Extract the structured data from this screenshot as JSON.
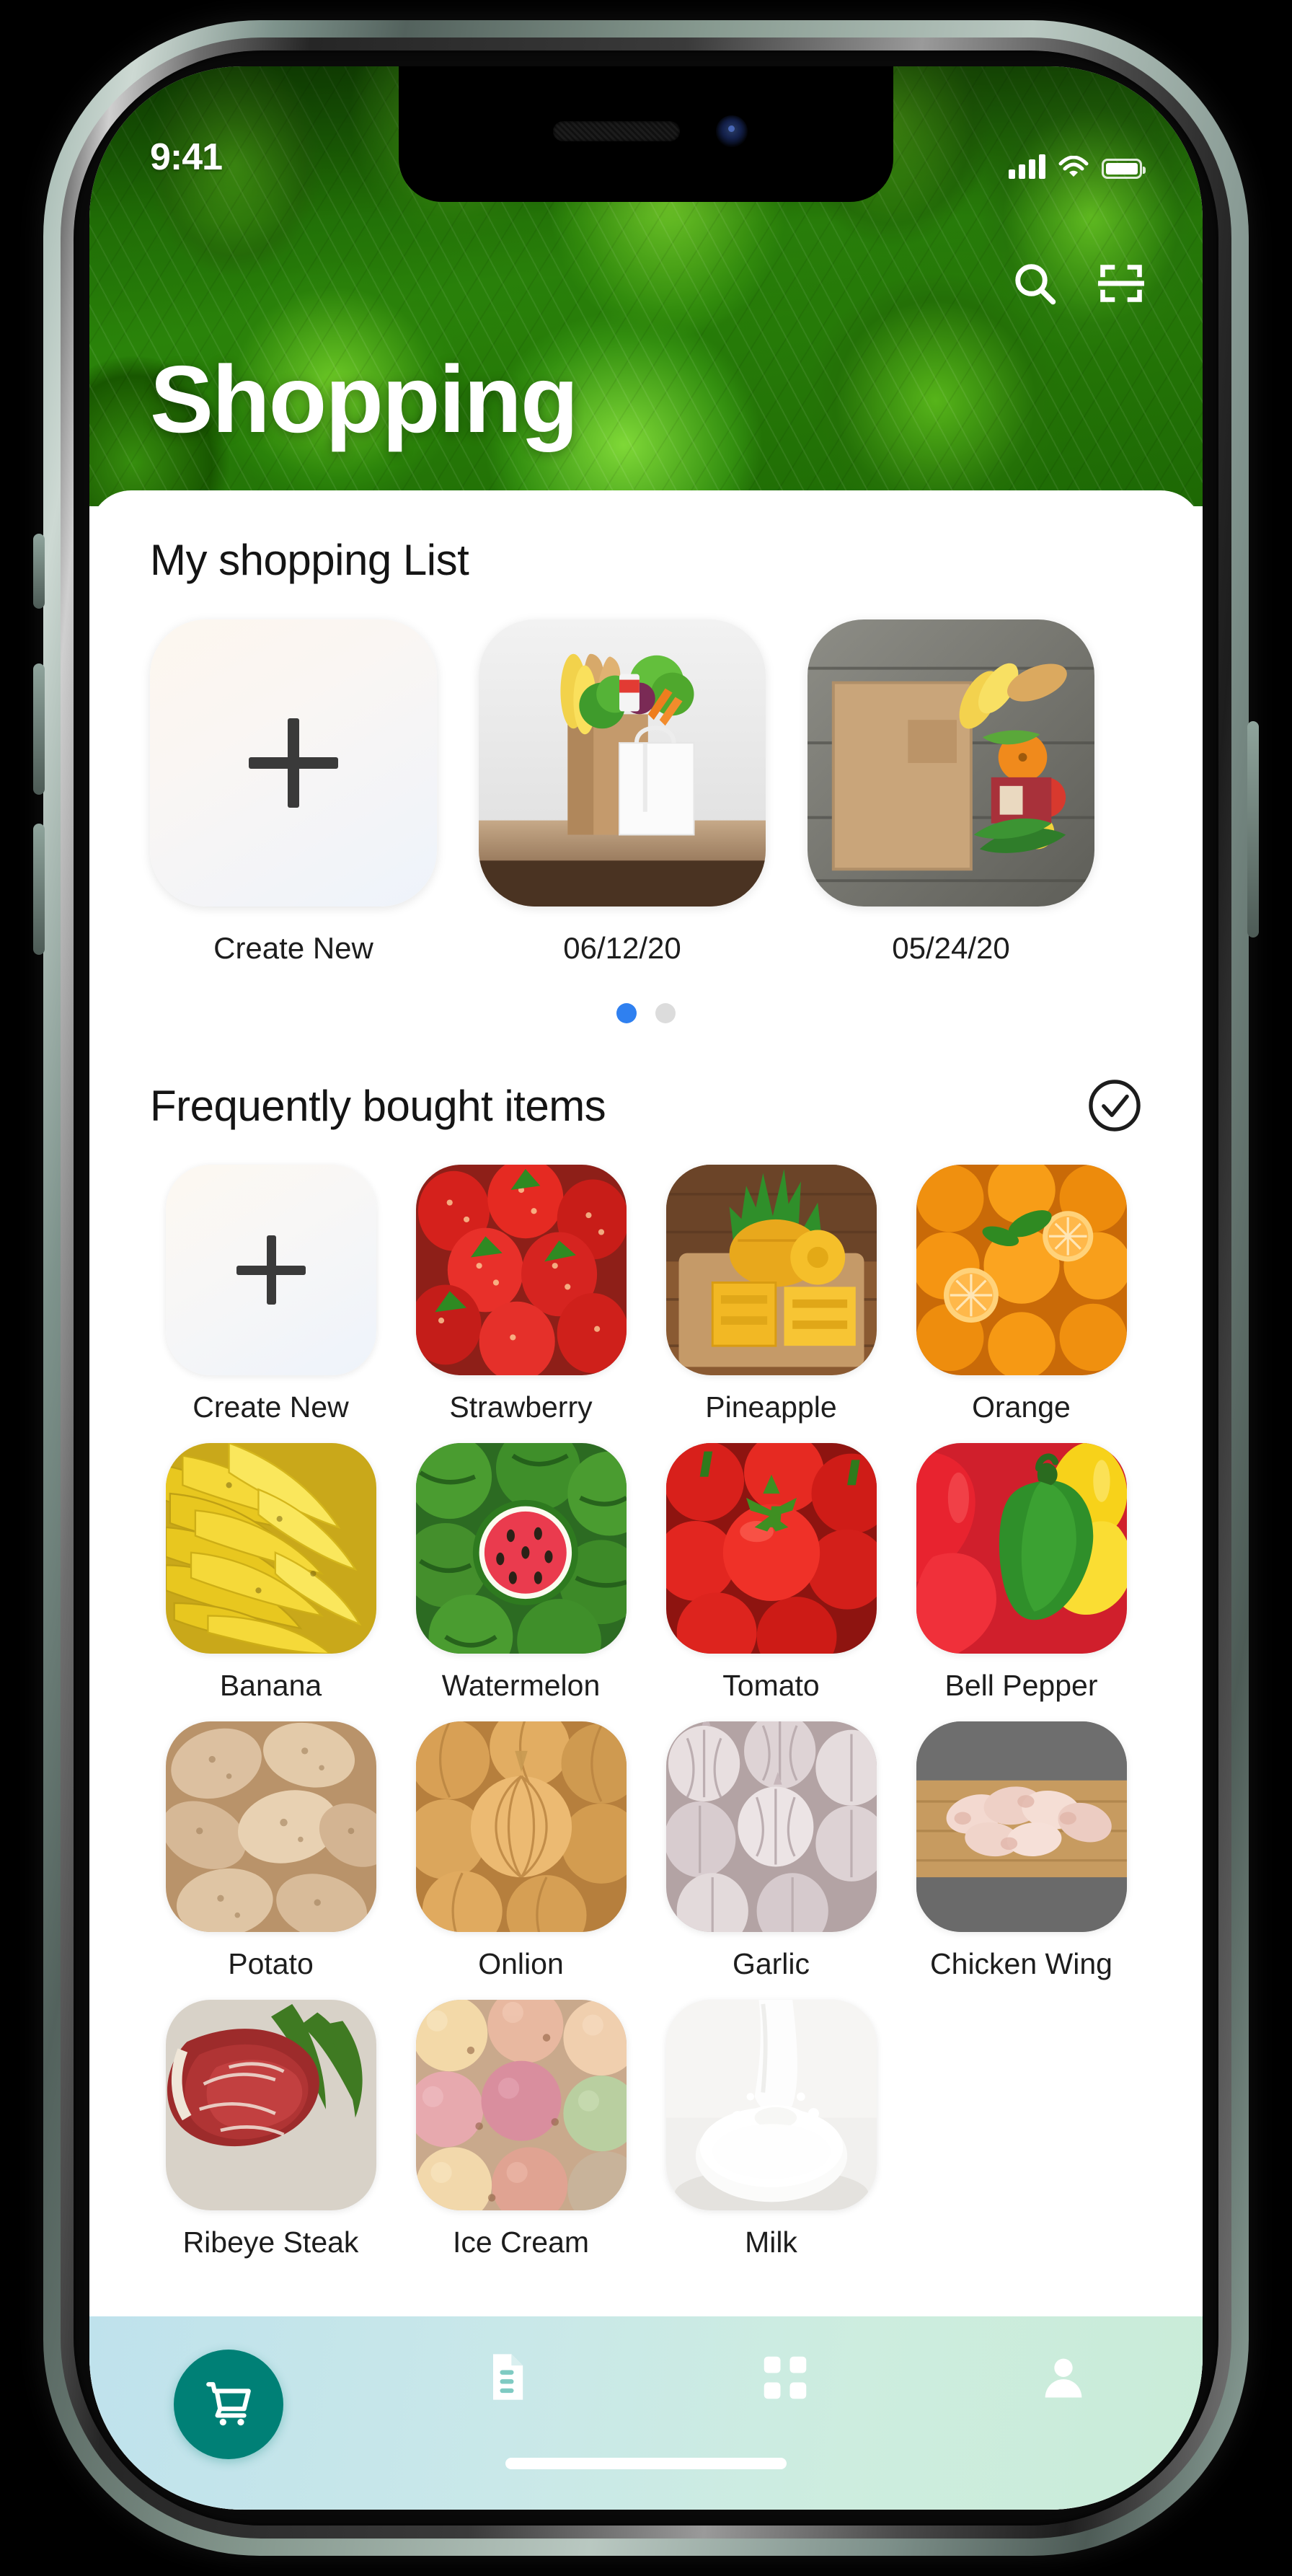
{
  "status_bar": {
    "time": "9:41",
    "icons": [
      "signal-bars",
      "wifi",
      "battery-full"
    ]
  },
  "header": {
    "title": "Shopping",
    "actions": [
      {
        "name": "search-icon",
        "label": "Search"
      },
      {
        "name": "scan-icon",
        "label": "Scan barcode"
      }
    ]
  },
  "shopping_lists": {
    "section_title": "My shopping List",
    "items": [
      {
        "label": "Create New",
        "type": "add"
      },
      {
        "label": "06/12/20",
        "type": "list"
      },
      {
        "label": "05/24/20",
        "type": "list"
      }
    ],
    "pager": {
      "total": 2,
      "active": 0,
      "active_color": "#2f80f0",
      "inactive_color": "#dcdcdc"
    }
  },
  "frequently_bought": {
    "section_title": "Frequently bought items",
    "action_icon": "check-circle-icon",
    "items": [
      {
        "label": "Create New",
        "type": "add"
      },
      {
        "label": "Strawberry",
        "type": "item"
      },
      {
        "label": "Pineapple",
        "type": "item"
      },
      {
        "label": "Orange",
        "type": "item"
      },
      {
        "label": "Banana",
        "type": "item"
      },
      {
        "label": "Watermelon",
        "type": "item"
      },
      {
        "label": "Tomato",
        "type": "item"
      },
      {
        "label": "Bell Pepper",
        "type": "item"
      },
      {
        "label": "Potato",
        "type": "item"
      },
      {
        "label": "Onlion",
        "type": "item"
      },
      {
        "label": "Garlic",
        "type": "item"
      },
      {
        "label": "Chicken Wing",
        "type": "item"
      },
      {
        "label": "Ribeye Steak",
        "type": "item"
      },
      {
        "label": "Ice Cream",
        "type": "item"
      },
      {
        "label": "Milk",
        "type": "item"
      }
    ]
  },
  "tab_bar": {
    "active_index": 0,
    "active_color": "#008076",
    "tabs": [
      {
        "name": "cart-icon",
        "label": "Cart"
      },
      {
        "name": "document-icon",
        "label": "Lists"
      },
      {
        "name": "grid-icon",
        "label": "Categories"
      },
      {
        "name": "person-icon",
        "label": "Profile"
      }
    ]
  }
}
